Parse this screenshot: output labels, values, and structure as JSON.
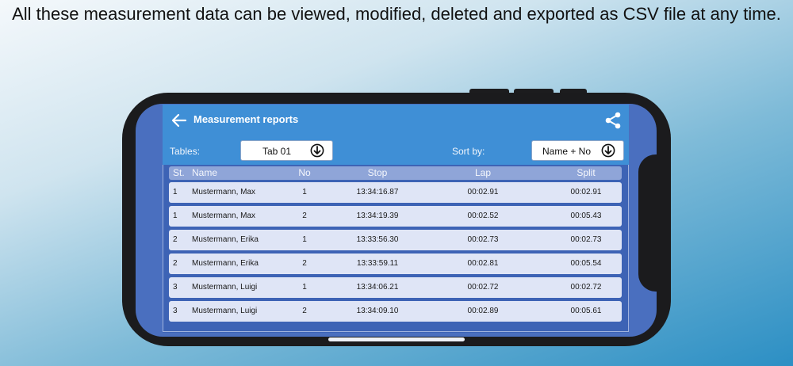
{
  "caption": "All these measurement data can be viewed, modified, deleted and exported as CSV file at any time.",
  "header": {
    "title": "Measurement reports",
    "back_icon": "arrow-left-icon",
    "share_icon": "share-icon"
  },
  "controls": {
    "tables_label": "Tables:",
    "tables_value": "Tab 01",
    "sort_label": "Sort by:",
    "sort_value": "Name + No",
    "dropdown_icon": "circle-arrow-down-icon"
  },
  "table": {
    "columns": [
      "St.",
      "Name",
      "No",
      "Stop",
      "Lap",
      "Split"
    ],
    "rows": [
      {
        "st": "1",
        "name": "Mustermann, Max",
        "no": "1",
        "stop": "13:34:16.87",
        "lap": "00:02.91",
        "split": "00:02.91"
      },
      {
        "st": "1",
        "name": "Mustermann, Max",
        "no": "2",
        "stop": "13:34:19.39",
        "lap": "00:02.52",
        "split": "00:05.43"
      },
      {
        "st": "2",
        "name": "Mustermann, Erika",
        "no": "1",
        "stop": "13:33:56.30",
        "lap": "00:02.73",
        "split": "00:02.73"
      },
      {
        "st": "2",
        "name": "Mustermann, Erika",
        "no": "2",
        "stop": "13:33:59.11",
        "lap": "00:02.81",
        "split": "00:05.54"
      },
      {
        "st": "3",
        "name": "Mustermann, Luigi",
        "no": "1",
        "stop": "13:34:06.21",
        "lap": "00:02.72",
        "split": "00:02.72"
      },
      {
        "st": "3",
        "name": "Mustermann, Luigi",
        "no": "2",
        "stop": "13:34:09.10",
        "lap": "00:02.89",
        "split": "00:05.61"
      }
    ]
  },
  "colors": {
    "header_blue": "#3f8fd6",
    "table_background": "#3d63b5",
    "row_background": "#dfe5f6",
    "phone_frame": "#1b1b1d"
  }
}
